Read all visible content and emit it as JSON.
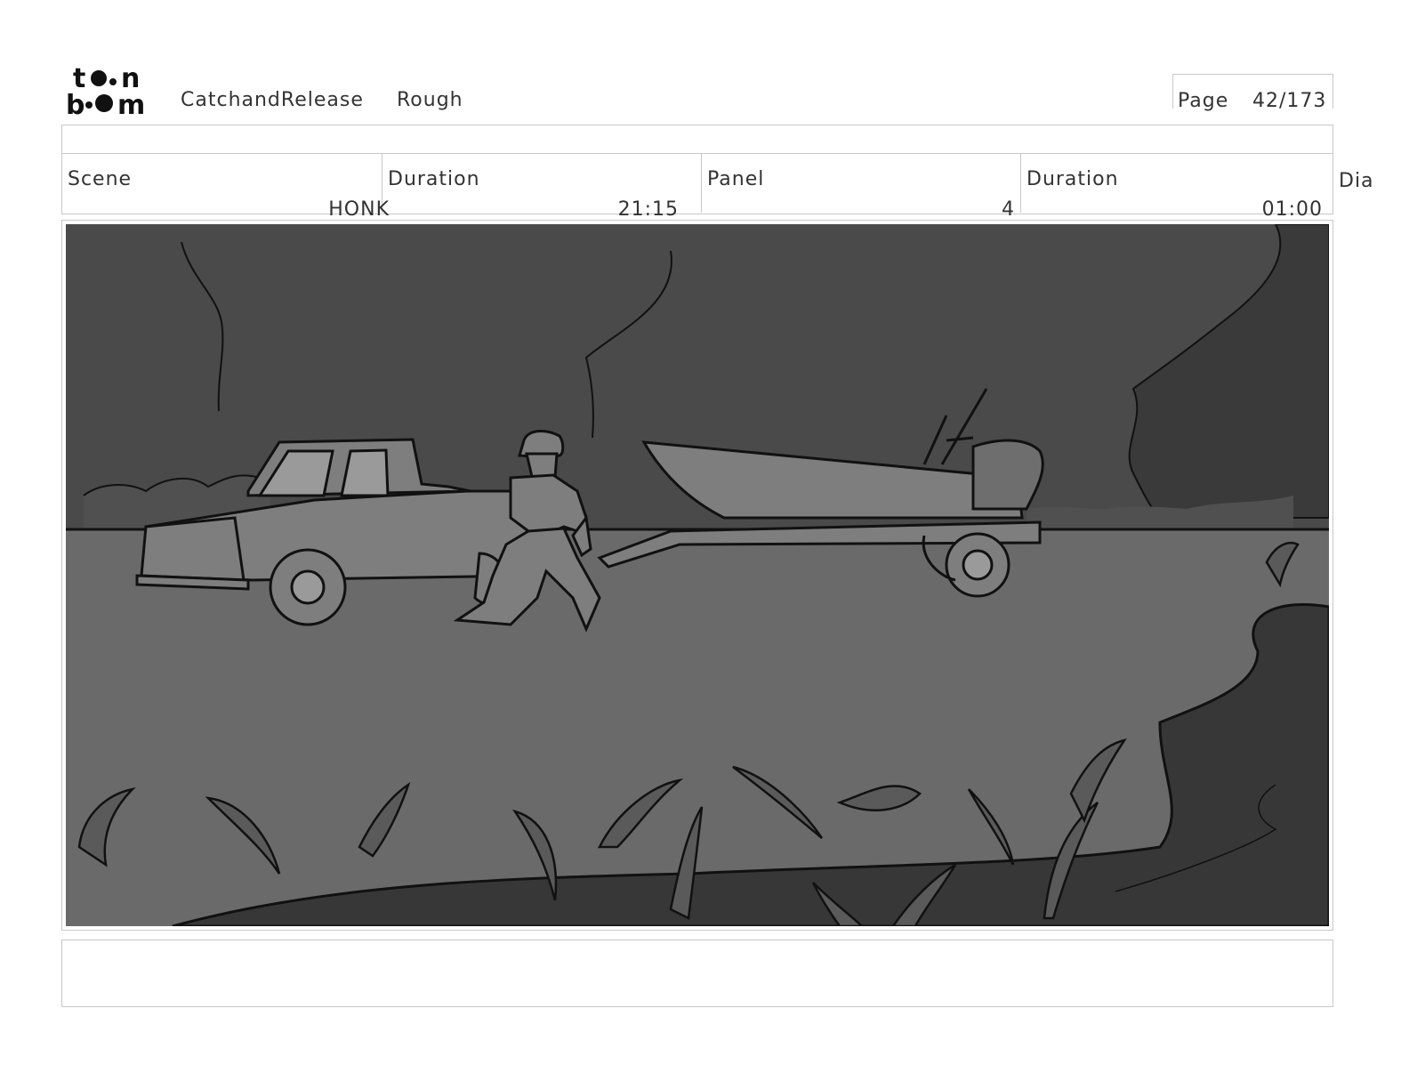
{
  "header": {
    "logo_alt": "toon boom",
    "project_name": "CatchandRelease",
    "status": "Rough",
    "page_label": "Page",
    "page_number": "42/173"
  },
  "info_row": {
    "scene_label": "Scene",
    "scene_value": "HONK",
    "scene_duration_label": "Duration",
    "scene_duration_value": "21:15",
    "panel_label": "Panel",
    "panel_value": "4",
    "panel_duration_label": "Duration",
    "panel_duration_value": "01:00",
    "dialogue_label": "Dia"
  },
  "panel": {
    "description": "",
    "colors": {
      "sky_dark": "#404040",
      "trees": "#4d4d4d",
      "ground": "#6a6a6a",
      "water": "#383838",
      "vehicles": "#7d7d7d",
      "line": "#111111"
    }
  },
  "caption": ""
}
